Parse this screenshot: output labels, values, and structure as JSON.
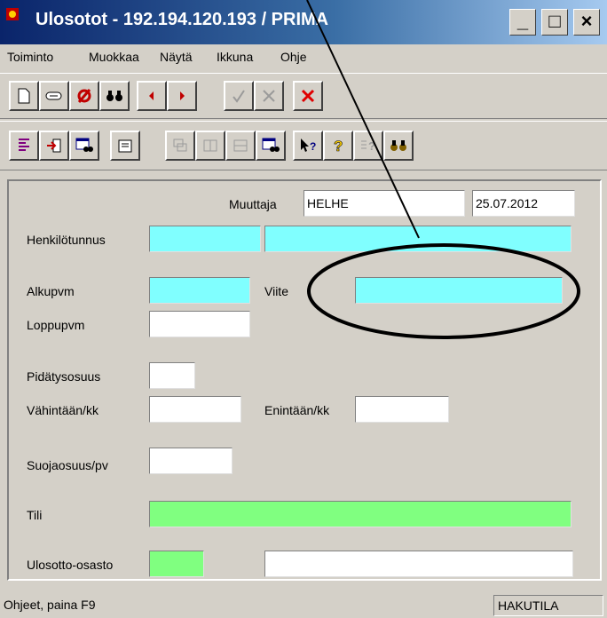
{
  "window": {
    "title": "Ulosotot - 192.194.120.193 / PRIMA",
    "minimize_glyph": "_",
    "maximize_glyph": "□",
    "close_glyph": "×"
  },
  "menu": [
    "Toiminto",
    "Muokkaa",
    "Näytä",
    "Ikkuna",
    "Ohje"
  ],
  "form": {
    "muuttaja_label": "Muuttaja",
    "muuttaja_value": "HELHE",
    "date_value": "25.07.2012",
    "henkilotunnus_label": "Henkilötunnus",
    "henkilotunnus_value": "",
    "henkilo_name_value": "",
    "alkupvm_label": "Alkupvm",
    "alkupvm_value": "",
    "viite_label": "Viite",
    "viite_value": "",
    "loppupvm_label": "Loppupvm",
    "loppupvm_value": "",
    "pidatysosuus_label": "Pidätysosuus",
    "pidatysosuus_value": "",
    "vahintaan_label": "Vähintään/kk",
    "vahintaan_value": "",
    "enintaan_label": "Enintään/kk",
    "enintaan_value": "",
    "suojaosuus_label": "Suojaosuus/pv",
    "suojaosuus_value": "",
    "tili_label": "Tili",
    "tili_value": "",
    "ulosotto_label": "Ulosotto-osasto",
    "ulosotto_code_value": "",
    "ulosotto_name_value": ""
  },
  "status": {
    "help_text": "Ohjeet, paina F9",
    "mode": "HAKUTILA"
  },
  "colors": {
    "required_field": "#80ffff",
    "account_field": "#80ff80",
    "face": "#d4d0c8"
  }
}
